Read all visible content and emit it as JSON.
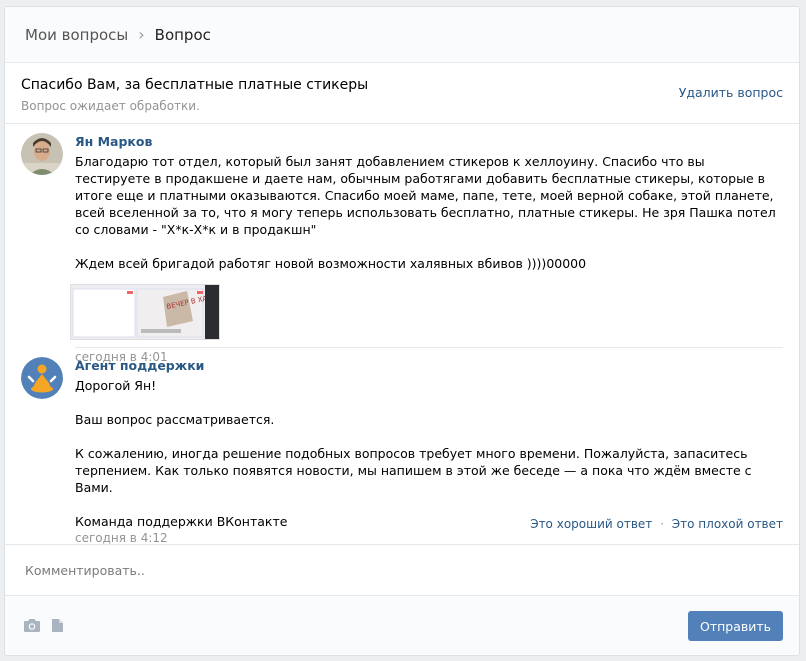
{
  "header": {
    "breadcrumb_parent": "Мои вопросы",
    "separator": "›",
    "breadcrumb_current": "Вопрос"
  },
  "question": {
    "title": "Спасибо Вам, за бесплатные платные стикеры",
    "status": "Вопрос ожидает обработки.",
    "delete_label": "Удалить вопрос"
  },
  "messages": [
    {
      "author": "Ян Марков",
      "paragraphs": [
        "Благодарю тот отдел, который был занят добавлением стикеров к хеллоуину. Спасибо что вы тестируете в продакшене и даете нам, обычным работягами добавить бесплатные стикеры, которые в итоге еще и платными оказываются. Спасибо моей маме, папе, тете, моей верной собаке, этой планете, всей вселенной за то, что я могу теперь использовать бесплатно, платные стикеры. Не зря Пашка потел со словами - \"Х*к-Х*к и в продакшн\"",
        "Ждем всей бригадой работяг новой возможности халявных вбивов ))))00000"
      ],
      "attachment": {
        "sticker_text": "ВЕЧЕР В ХАТУ!"
      },
      "time": "сегодня в 4:01"
    },
    {
      "author": "Агент поддержки",
      "paragraphs": [
        "Дорогой Ян!",
        "Ваш вопрос рассматривается.",
        "К сожалению, иногда решение подобных вопросов требует много времени. Пожалуйста, запаситесь терпением. Как только появятся новости, мы напишем в этой же беседе — а пока что ждём вместе с Вами.",
        "Команда поддержки ВКонтакте"
      ],
      "time": "сегодня в 4:12",
      "rate_good": "Это хороший ответ",
      "rate_sep": "·",
      "rate_bad": "Это плохой ответ"
    }
  ],
  "composer": {
    "placeholder": "Комментировать..",
    "send_label": "Отправить"
  },
  "icons": {
    "camera": "camera-icon",
    "document": "document-icon"
  },
  "colors": {
    "link": "#2a5885",
    "button": "#5181b8",
    "background": "#edeef0",
    "border": "#e7e8ec",
    "muted": "#939393"
  }
}
